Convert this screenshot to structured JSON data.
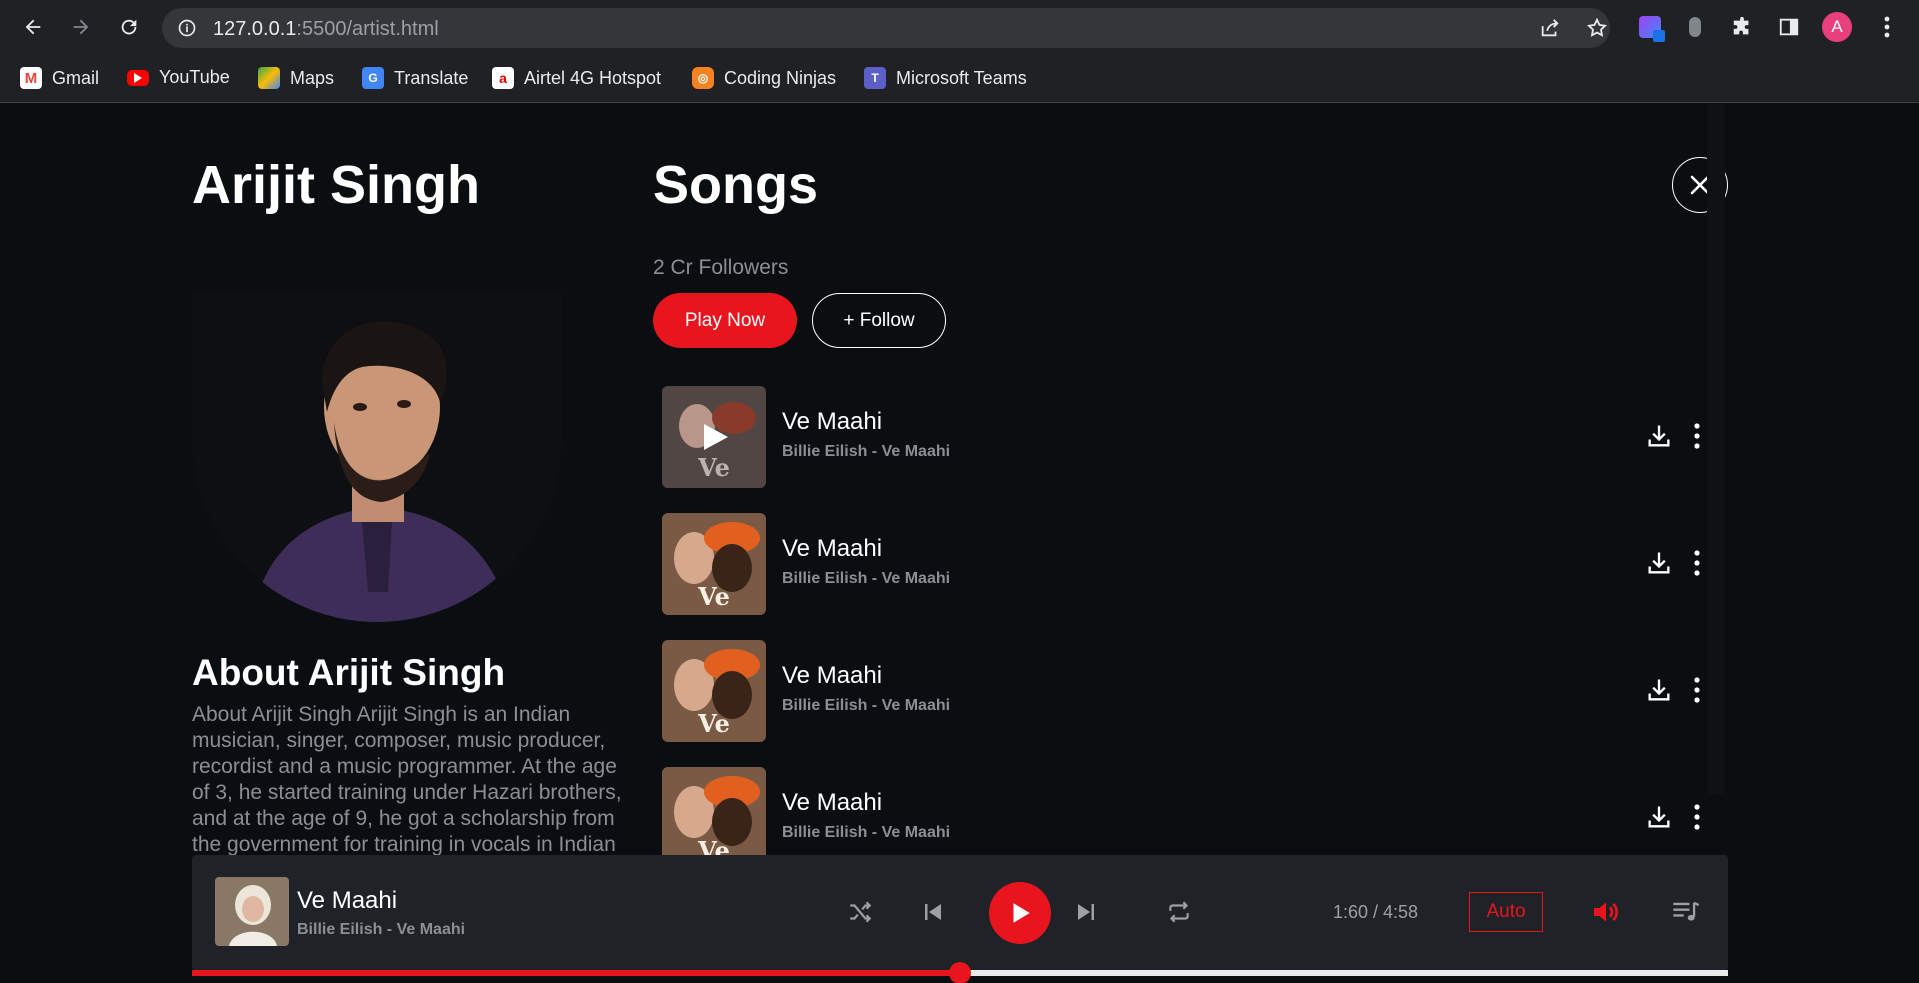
{
  "browser": {
    "url_host": "127.0.0.1",
    "url_rest": ":5500/artist.html",
    "bookmarks": [
      "Gmail",
      "YouTube",
      "Maps",
      "Translate",
      "Airtel 4G Hotspot",
      "Coding Ninjas",
      "Microsoft Teams"
    ],
    "profile_initial": "A"
  },
  "artist": {
    "name": "Arijit Singh",
    "about_title": "About Arijit Singh",
    "about_text": "About Arijit Singh Arijit Singh is an Indian musician, singer, composer, music producer, recordist and a music programmer. At the age of 3, he started training under Hazari brothers, and at the age of 9, he got a scholarship from the government for training in vocals in Indian classical music. He is one of the most successful singers in the History of Indian"
  },
  "songs_section": {
    "title": "Songs",
    "followers": "2 Cr Followers",
    "play_now": "Play Now",
    "follow": "+ Follow"
  },
  "songs": [
    {
      "title": "Ve Maahi",
      "subtitle": "Billie Eilish - Ve Maahi"
    },
    {
      "title": "Ve Maahi",
      "subtitle": "Billie Eilish - Ve Maahi"
    },
    {
      "title": "Ve Maahi",
      "subtitle": "Billie Eilish - Ve Maahi"
    },
    {
      "title": "Ve Maahi",
      "subtitle": "Billie Eilish - Ve Maahi"
    }
  ],
  "player": {
    "title": "Ve Maahi",
    "subtitle": "Billie Eilish - Ve Maahi",
    "time": "1:60 / 4:58",
    "auto_label": "Auto",
    "progress": 0.5
  },
  "colors": {
    "accent": "#e8151f",
    "background": "#0b0e11",
    "player_bg": "#202228",
    "muted_text": "#8b8f94"
  }
}
